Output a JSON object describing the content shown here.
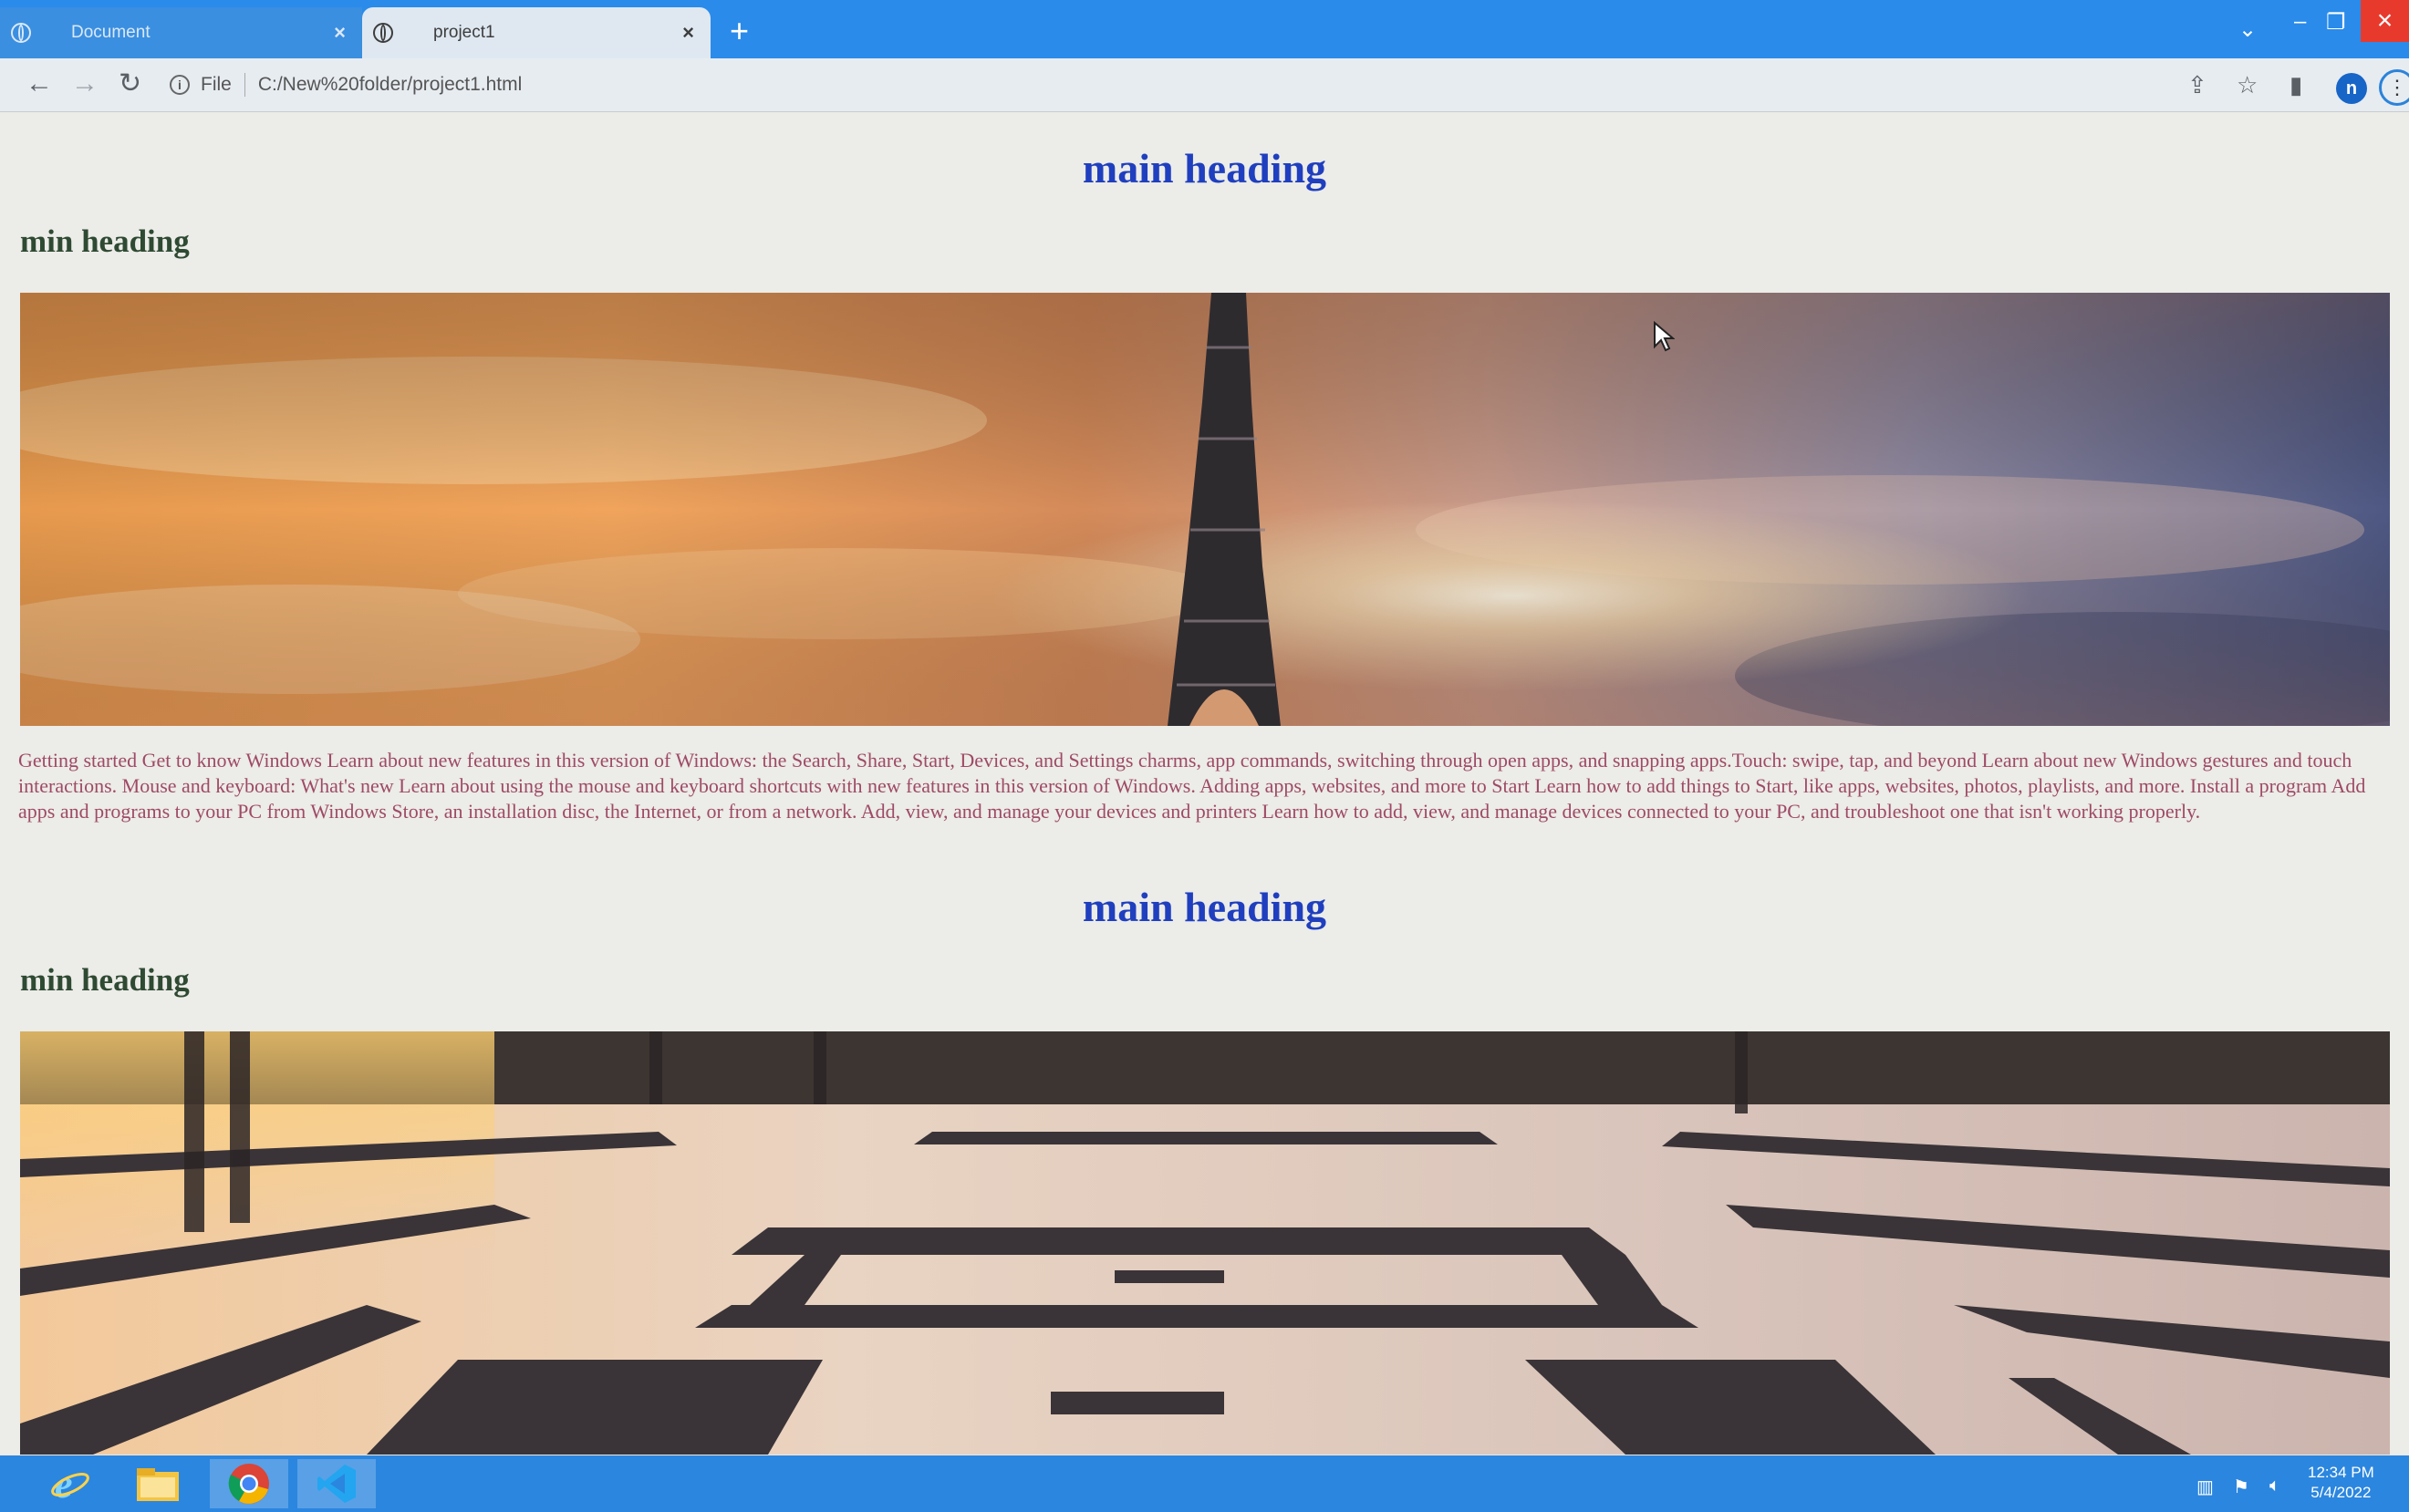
{
  "browser": {
    "tabs": [
      {
        "title": "Document",
        "close": "×"
      },
      {
        "title": "project1",
        "close": "×"
      }
    ],
    "new_tab": "+",
    "address": {
      "scheme_label": "File",
      "url": "C:/New%20folder/project1.html"
    },
    "profile_initial": "n"
  },
  "page": {
    "sections": [
      {
        "main_heading": "main heading",
        "min_heading": "min heading"
      },
      {
        "main_heading": "main heading",
        "min_heading": "min heading"
      }
    ],
    "paragraph": "Getting started Get to know Windows Learn about new features in this version of Windows: the Search, Share, Start, Devices, and Settings charms, app commands, switching through open apps, and snapping apps.Touch: swipe, tap, and beyond Learn about new Windows gestures and touch interactions. Mouse and keyboard: What's new Learn about using the mouse and keyboard shortcuts with new features in this version of Windows. Adding apps, websites, and more to Start Learn how to add things to Start, like apps, websites, photos, playlists, and more. Install a program Add apps and programs to your PC from Windows Store, an installation disc, the Internet, or from a network. Add, view, and manage your devices and printers Learn how to add, view, and manage devices connected to your PC, and troubleshoot one that isn't working properly.",
    "colors": {
      "main_heading": "#1f3fbf",
      "min_heading": "#2e4a32",
      "paragraph": "#9e4a66"
    }
  },
  "taskbar": {
    "apps": [
      "internet-explorer-icon",
      "file-explorer-icon",
      "chrome-icon",
      "vscode-icon"
    ],
    "clock_time": "12:34 PM",
    "clock_date": "5/4/2022"
  }
}
